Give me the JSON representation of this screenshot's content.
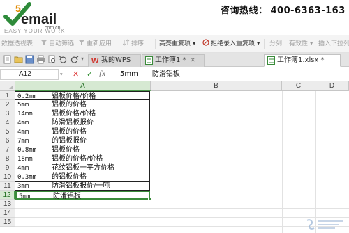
{
  "banner": {
    "logo": {
      "top_text": "5",
      "main_text": "email",
      "domain_text": ".com.cn"
    },
    "slogan": "EASY YOUR WORK",
    "hotline_label": "咨询热线：",
    "hotline_number": "400-6363-163"
  },
  "ribbon": {
    "items": [
      {
        "label": "数据透视表",
        "icon": "pivot-table-icon"
      },
      {
        "label": "自动筛选",
        "icon": "filter-icon"
      },
      {
        "label": "重新应用",
        "icon": "reapply-icon"
      },
      {
        "label": "排序",
        "icon": "sort-icon"
      },
      {
        "label": "高亮重复项",
        "icon": "highlight-dup-icon"
      },
      {
        "label": "拒绝录入重复项",
        "icon": "reject-dup-icon"
      },
      {
        "label": "分列",
        "icon": "split-column-icon"
      },
      {
        "label": "有效性",
        "icon": "validation-icon"
      },
      {
        "label": "插入下拉列",
        "icon": "dropdown-insert-icon"
      }
    ]
  },
  "tabs": {
    "wps_home": "我的WPS",
    "tab1": "工作簿1 *",
    "tab2": "工作簿1.xlsx *"
  },
  "formula_bar": {
    "cell_ref": "A12",
    "cancel_symbol": "✕",
    "enter_symbol": "✓",
    "fx_symbol": "fx",
    "value_size": "5mm",
    "value_desc": "防滑铝板"
  },
  "grid": {
    "columns": [
      "A",
      "B",
      "C",
      "D"
    ],
    "row_numbers": [
      "1",
      "2",
      "3",
      "4",
      "5",
      "6",
      "7",
      "8",
      "9",
      "10",
      "11",
      "12",
      "13",
      "14",
      "15"
    ],
    "rows": [
      {
        "size": "0.2mm",
        "desc": "铝板价格/价格"
      },
      {
        "size": "5mm",
        "desc": "铝板的价格"
      },
      {
        "size": "14mm",
        "desc": "铝板价格/价格"
      },
      {
        "size": "4mm",
        "desc": "防滑铝板报价"
      },
      {
        "size": "4mm",
        "desc": "铝板的价格"
      },
      {
        "size": "7mm",
        "desc": "的铝板报价"
      },
      {
        "size": "0.8mm",
        "desc": "铝板价格"
      },
      {
        "size": "18mm",
        "desc": "铝板的价格/价格"
      },
      {
        "size": "4mm",
        "desc": "花纹铝板一平方价格"
      },
      {
        "size": "0.3mm",
        "desc": "的铝板价格"
      },
      {
        "size": "3mm",
        "desc": "防滑铝板报价/一吨"
      },
      {
        "size": "5mm",
        "desc": "防滑铝板"
      }
    ],
    "selected_cell": "A12"
  },
  "colors": {
    "accent_green": "#3a8b3a",
    "wps_red": "#d0342c",
    "logo_green": "#2e8b3a"
  }
}
